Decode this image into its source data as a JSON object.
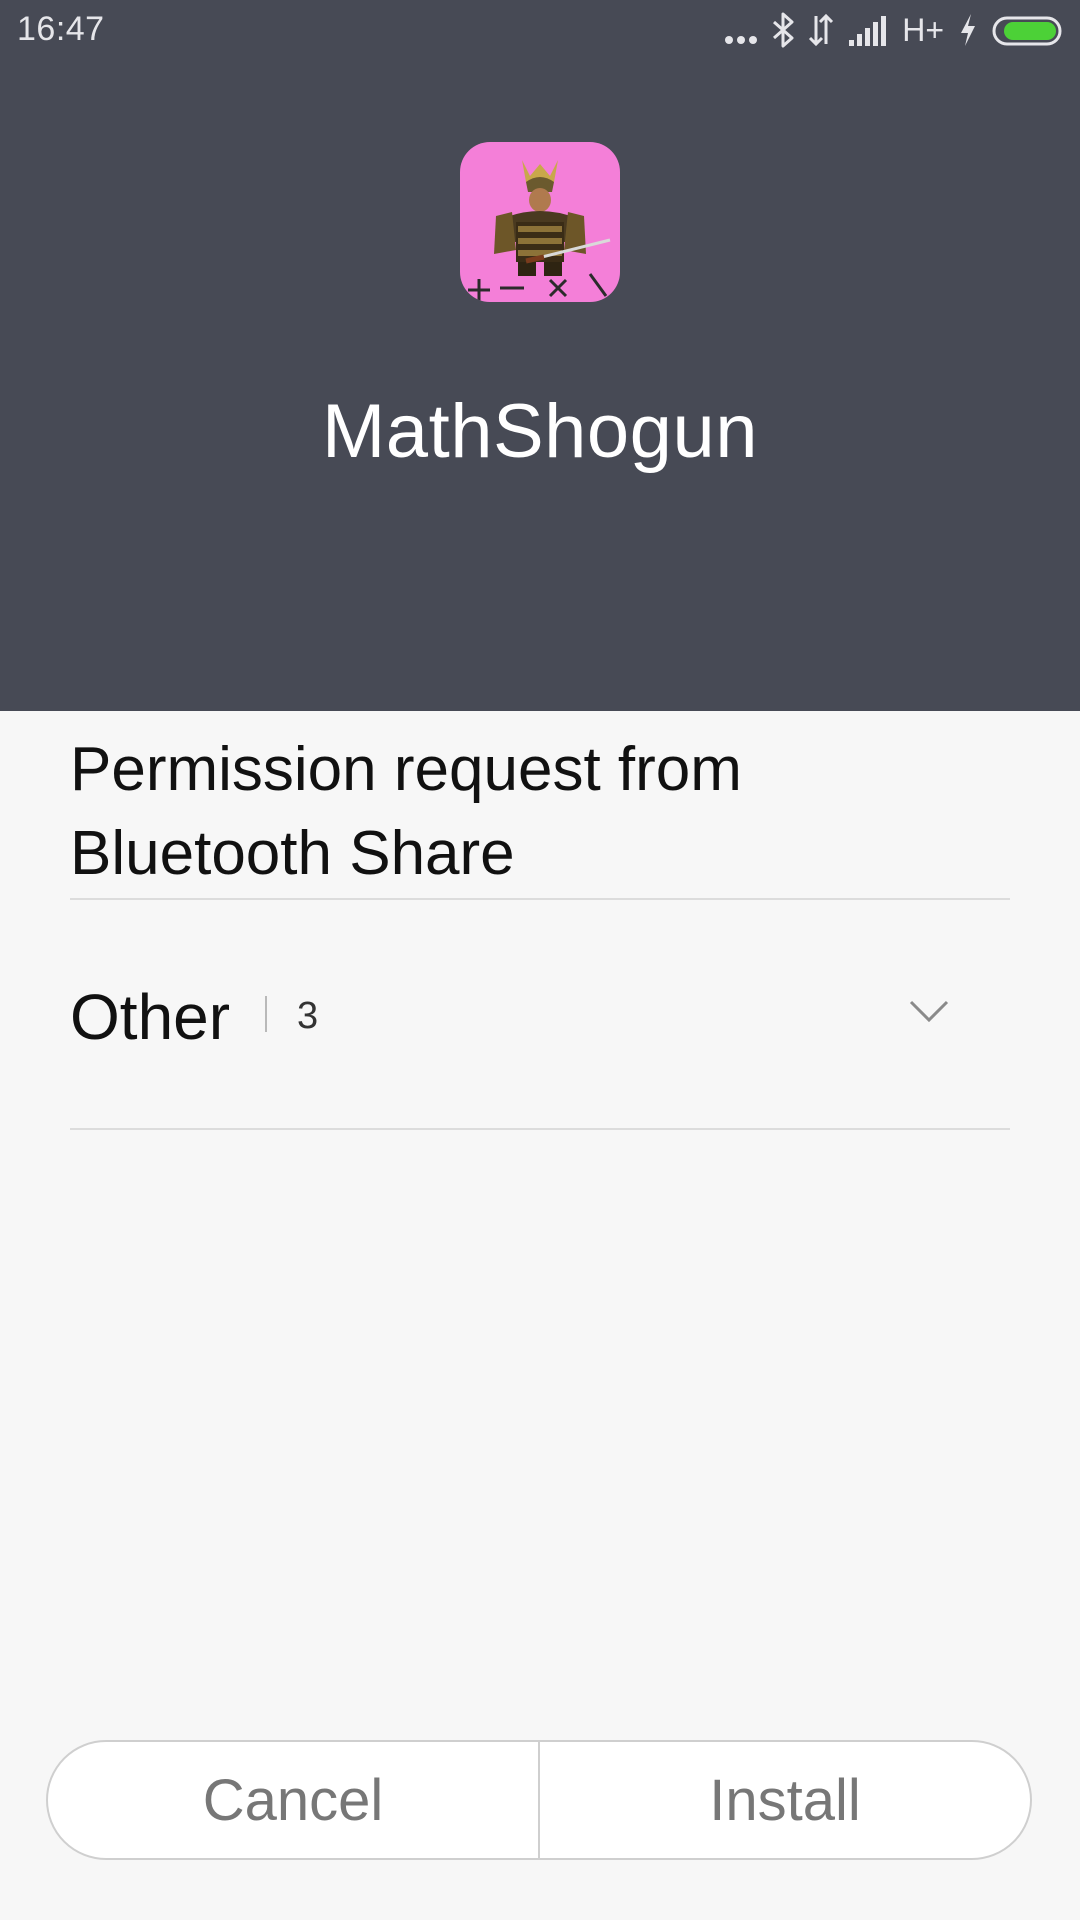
{
  "status_bar": {
    "time": "16:47",
    "network": "H+",
    "icons": [
      "more-dots-icon",
      "bluetooth-icon",
      "data-arrows-icon",
      "signal-icon",
      "charging-icon",
      "battery-icon"
    ],
    "battery_color": "#4cd137"
  },
  "app": {
    "name": "MathShogun",
    "icon": "mathshogun-app-icon",
    "icon_bg": "#f47fd8"
  },
  "permissions": {
    "title": "Permission request from Bluetooth Share",
    "groups": [
      {
        "name": "Other",
        "count": "3"
      }
    ]
  },
  "buttons": {
    "cancel": "Cancel",
    "install": "Install"
  },
  "colors": {
    "header_bg": "#474a55",
    "page_bg": "#f7f7f7"
  }
}
